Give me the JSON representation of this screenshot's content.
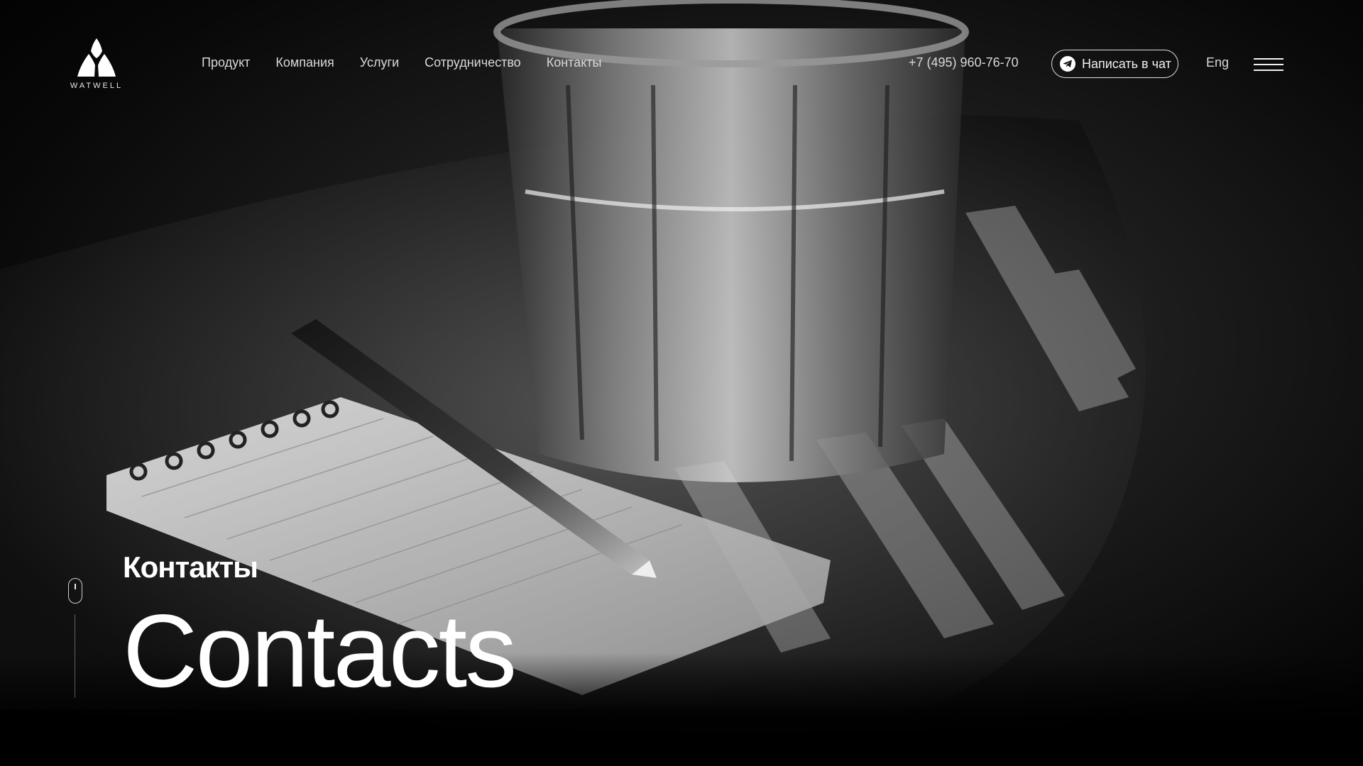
{
  "brand": {
    "name": "WATWELL",
    "logo_icon": "watwell-triangle-logo"
  },
  "nav": {
    "items": [
      {
        "label": "Продукт"
      },
      {
        "label": "Компания"
      },
      {
        "label": "Услуги"
      },
      {
        "label": "Сотрудничество"
      },
      {
        "label": "Контакты"
      }
    ]
  },
  "header": {
    "phone": "+7 (495) 960-76-70",
    "chat_button_label": "Написать в чат",
    "chat_button_icon": "telegram-icon",
    "language": "Eng",
    "menu_icon": "hamburger-menu-icon"
  },
  "hero": {
    "subtitle": "Контакты",
    "title": "Contacts",
    "scroll_icon": "mouse-scroll-icon",
    "background_image": "glass-of-water-notebook-pen-photo"
  },
  "colors": {
    "background": "#000000",
    "text": "#ffffff",
    "nav_text": "#d9d9d9"
  }
}
